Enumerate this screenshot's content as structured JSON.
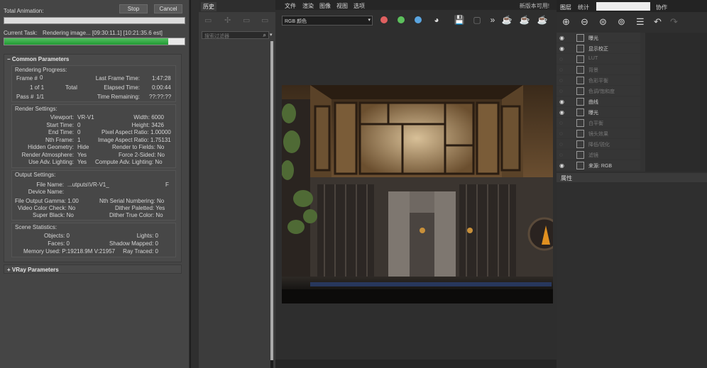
{
  "render_dialog": {
    "total_animation_label": "Total Animation:",
    "stop_label": "Stop",
    "cancel_label": "Cancel",
    "current_task_label": "Current Task:",
    "current_task_value": "Rendering image... [09:30:11.1] [10:21:35.6 est]",
    "progress": 0.91,
    "common_title": "Common Parameters",
    "rendering_progress_title": "Rendering Progress:",
    "frame_label": "Frame #",
    "frame_value": "0",
    "of_value": "1 of 1",
    "total_label": "Total",
    "pass_label": "Pass #",
    "pass_value": "1/1",
    "last_frame_time_label": "Last Frame Time:",
    "last_frame_time_value": "1:47:28",
    "elapsed_label": "Elapsed Time:",
    "elapsed_value": "0:00:44",
    "remaining_label": "Time Remaining:",
    "remaining_value": "??:??:??",
    "render_settings_title": "Render Settings:",
    "viewport_label": "Viewport:",
    "viewport_value": "VR-V1",
    "start_time_label": "Start Time:",
    "start_time_value": "0",
    "end_time_label": "End Time:",
    "end_time_value": "0",
    "nth_frame_label": "Nth Frame:",
    "nth_frame_value": "1",
    "hidden_geom_label": "Hidden Geometry:",
    "hidden_geom_value": "Hide",
    "render_atmos_label": "Render Atmosphere:",
    "render_atmos_value": "Yes",
    "use_adv_label": "Use Adv. Lighting:",
    "use_adv_value": "Yes",
    "width_label": "Width:",
    "width_value": "6000",
    "height_label": "Height:",
    "height_value": "3426",
    "pixel_aspect_label": "Pixel Aspect Ratio:",
    "pixel_aspect_value": "1.00000",
    "image_aspect_label": "Image Aspect Ratio:",
    "image_aspect_value": "1.75131",
    "render_fields_label": "Render to Fields:",
    "render_fields_value": "No",
    "force2_label": "Force 2-Sided:",
    "force2_value": "No",
    "compute_adv_label": "Compute Adv. Lighting:",
    "compute_adv_value": "No",
    "output_settings_title": "Output Settings:",
    "file_name_label": "File Name:",
    "file_name_value": "...utputs\\VR-V1_",
    "file_name_end": "F",
    "device_name_label": "Device Name:",
    "gamma_label": "File Output Gamma:",
    "gamma_value": "1.00",
    "video_check_label": "Video Color Check:",
    "video_check_value": "No",
    "super_black_label": "Super Black:",
    "super_black_value": "No",
    "nth_serial_label": "Nth Serial Numbering:",
    "nth_serial_value": "No",
    "dither_pal_label": "Dither Paletted:",
    "dither_pal_value": "Yes",
    "dither_true_label": "Dither True Color:",
    "dither_true_value": "No",
    "scene_stats_title": "Scene Statistics:",
    "objects_label": "Objects:",
    "objects_value": "0",
    "faces_label": "Faces:",
    "faces_value": "0",
    "memory_label": "Memory Used:",
    "memory_value": "P:19218.9M V:21957",
    "lights_label": "Lights:",
    "lights_value": "0",
    "shadow_label": "Shadow Mapped:",
    "shadow_value": "0",
    "raytraced_label": "Ray Traced:",
    "raytraced_value": "0",
    "vray_title": "VRay Parameters"
  },
  "history": {
    "tab_label": "历史",
    "filter_placeholder": "搜索过滤器"
  },
  "menu": [
    "文件",
    "渲染",
    "图像",
    "视图",
    "选项"
  ],
  "menu_right": "新版本可用!",
  "channel_select": "RGB 颜色",
  "channel_dots": [
    "#e06060",
    "#5cc05c",
    "#5aa5e0"
  ],
  "layers": {
    "tabs": [
      "图层",
      "统计",
      "协作"
    ],
    "items": [
      {
        "label": "曝光",
        "enabled": true
      },
      {
        "label": "显示校正",
        "enabled": true
      },
      {
        "label": "LUT",
        "enabled": false
      },
      {
        "label": "背景",
        "enabled": false
      },
      {
        "label": "色彩平衡",
        "enabled": false
      },
      {
        "label": "色调/饱和度",
        "enabled": false
      },
      {
        "label": "曲线",
        "enabled": true
      },
      {
        "label": "曝光",
        "enabled": true
      },
      {
        "label": "白平衡",
        "enabled": false
      },
      {
        "label": "镜头效果",
        "enabled": false
      },
      {
        "label": "降低/锐化",
        "enabled": false
      },
      {
        "label": "滤镜",
        "enabled": false
      },
      {
        "label": "来源: RGB",
        "enabled": true
      }
    ],
    "properties_label": "属性"
  }
}
